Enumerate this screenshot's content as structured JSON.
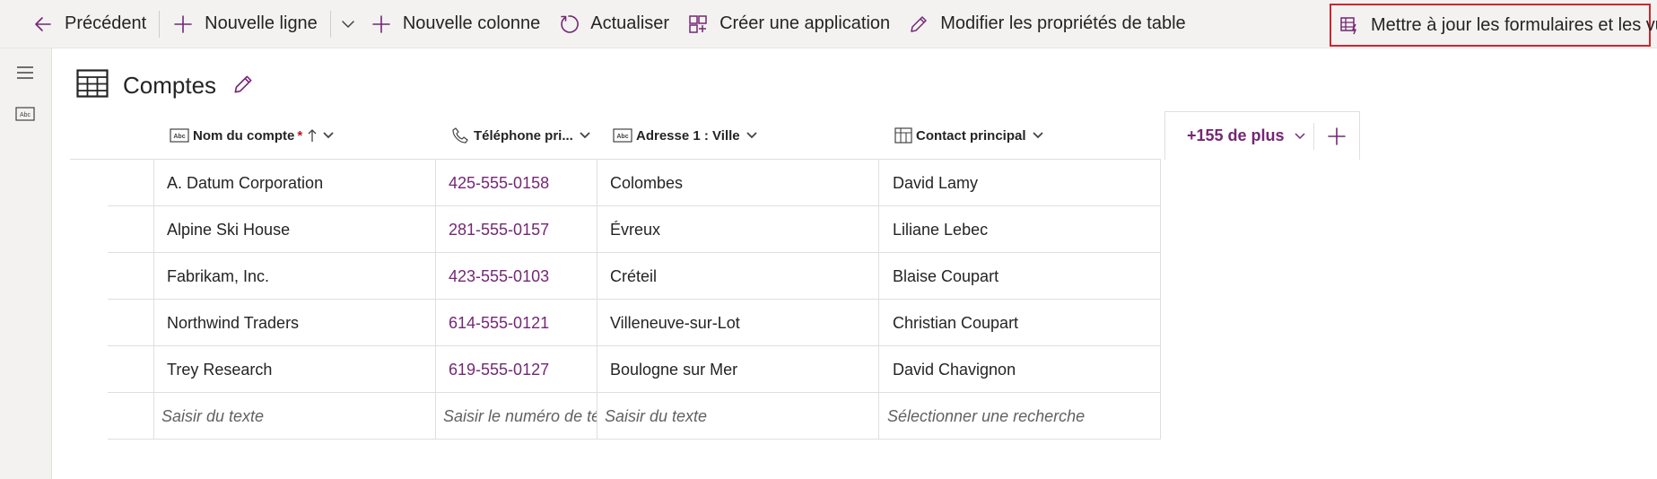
{
  "toolbar": {
    "back_label": "Précédent",
    "new_row_label": "Nouvelle ligne",
    "new_column_label": "Nouvelle colonne",
    "refresh_label": "Actualiser",
    "create_app_label": "Créer une application",
    "edit_properties_label": "Modifier les propriétés de table",
    "update_forms_label": "Mettre à jour les formulaires et les vues"
  },
  "page": {
    "title": "Comptes"
  },
  "grid": {
    "columns": [
      {
        "label": "Nom du compte",
        "required_marker": "*",
        "icon": "text-field-icon"
      },
      {
        "label": "Téléphone pri...",
        "icon": "phone-icon"
      },
      {
        "label": "Adresse 1 : Ville",
        "icon": "text-field-icon"
      },
      {
        "label": "Contact principal",
        "icon": "lookup-icon"
      }
    ],
    "rows": [
      {
        "name": "A. Datum Corporation",
        "phone": "425-555-0158",
        "city": "Colombes",
        "contact": "David Lamy"
      },
      {
        "name": "Alpine Ski House",
        "phone": "281-555-0157",
        "city": "Évreux",
        "contact": "Liliane Lebec"
      },
      {
        "name": "Fabrikam, Inc.",
        "phone": "423-555-0103",
        "city": "Créteil",
        "contact": "Blaise Coupart"
      },
      {
        "name": "Northwind Traders",
        "phone": "614-555-0121",
        "city": "Villeneuve-sur-Lot",
        "contact": "Christian Coupart"
      },
      {
        "name": "Trey Research",
        "phone": "619-555-0127",
        "city": "Boulogne sur Mer",
        "contact": "David Chavignon"
      }
    ],
    "new_row_placeholders": {
      "name": "Saisir du texte",
      "phone": "Saisir le numéro de téléphone",
      "city": "Saisir du texte",
      "contact": "Sélectionner une recherche"
    },
    "more_columns_label": "+155 de plus"
  },
  "colors": {
    "accent": "#742774",
    "highlight_border": "#d0252e",
    "toolbar_bg": "#f3f2f1"
  }
}
